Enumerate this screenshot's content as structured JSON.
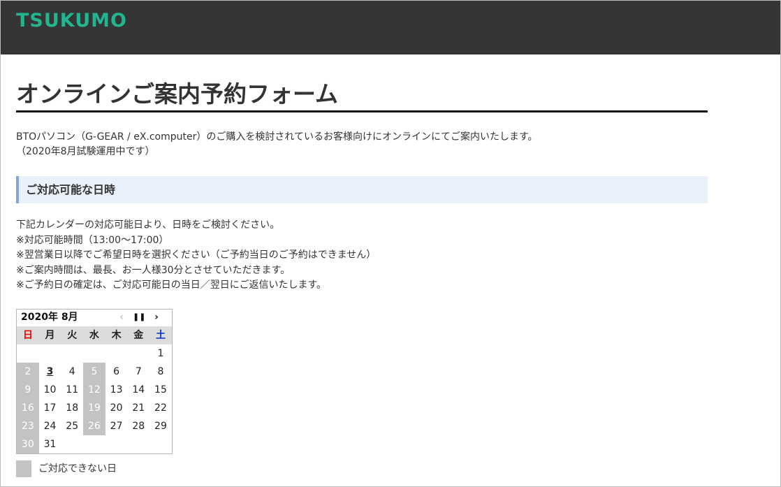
{
  "header": {
    "logo_text": "TSUKUMO",
    "brand_color": "#22b58f",
    "bg_color": "#353535"
  },
  "page": {
    "title": "オンラインご案内予約フォーム",
    "intro": [
      "BTOパソコン（G-GEAR / eX.computer）のご購入を検討されているお客様向けにオンラインにてご案内いたします。",
      "（2020年8月試験運用中です）"
    ]
  },
  "section": {
    "heading": "ご対応可能な日時",
    "notes": [
      "下記カレンダーの対応可能日より、日時をご検討ください。",
      "※対応可能時間（13:00〜17:00）",
      "※翌営業日以降でご希望日時を選択ください（ご予約当日のご予約はできません）",
      "※ご案内時間は、最長、お一人様30分とさせていただきます。",
      "※ご予約日の確定は、ご対応可能日の当日／翌日にご返信いたします。"
    ]
  },
  "calendar": {
    "title": "2020年 8月",
    "prev_icon": "‹",
    "pause_icon": "⏸",
    "next_icon": "›",
    "weekdays": [
      "日",
      "月",
      "火",
      "水",
      "木",
      "金",
      "土"
    ],
    "today": "3",
    "unavailable": [
      "2",
      "5",
      "9",
      "12",
      "16",
      "19",
      "23",
      "26",
      "30"
    ],
    "weeks": [
      [
        "",
        "",
        "",
        "",
        "",
        "",
        "1"
      ],
      [
        "2",
        "3",
        "4",
        "5",
        "6",
        "7",
        "8"
      ],
      [
        "9",
        "10",
        "11",
        "12",
        "13",
        "14",
        "15"
      ],
      [
        "16",
        "17",
        "18",
        "19",
        "20",
        "21",
        "22"
      ],
      [
        "23",
        "24",
        "25",
        "26",
        "27",
        "28",
        "29"
      ],
      [
        "30",
        "31",
        "",
        "",
        "",
        "",
        ""
      ]
    ],
    "unavailable_color": "#c3c3c3"
  },
  "legend": {
    "label": "ご対応できない日"
  }
}
